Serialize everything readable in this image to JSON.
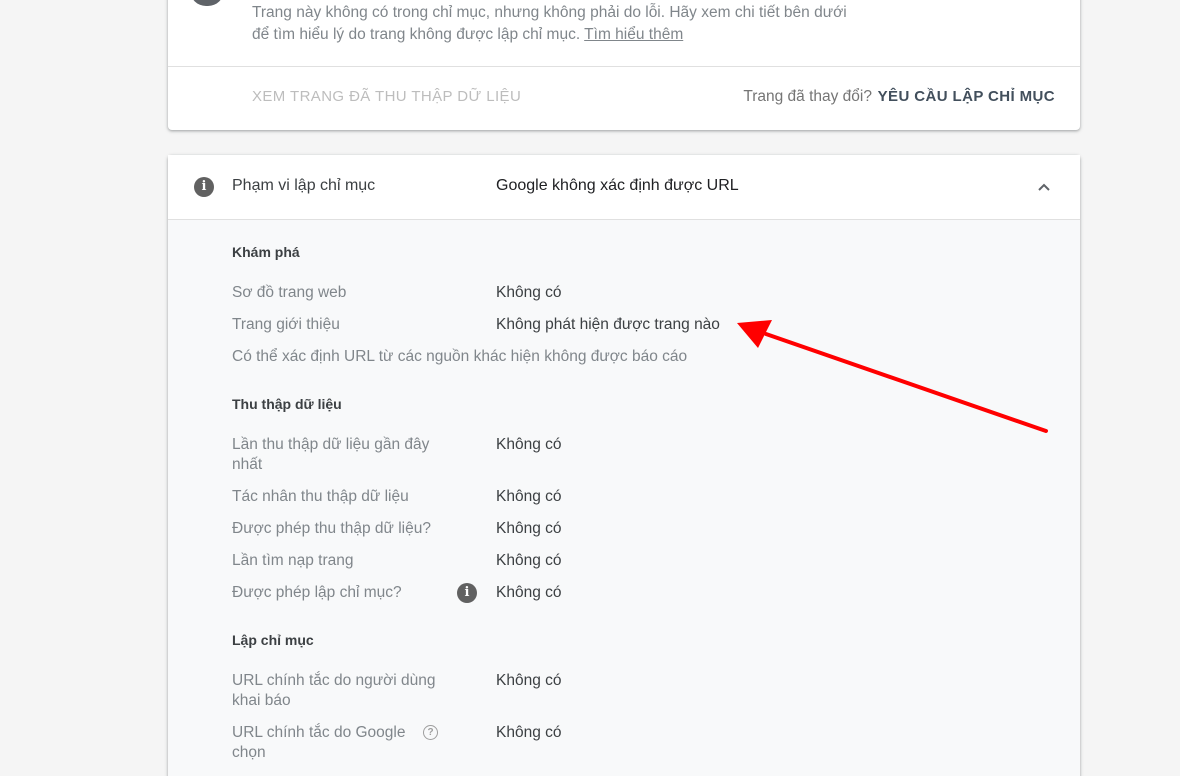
{
  "top_card": {
    "description": "Trang này không có trong chỉ mục, nhưng không phải do lỗi. Hãy xem chi tiết bên dưới để tìm hiểu lý do trang không được lập chỉ mục.",
    "learn_more": "Tìm hiểu thêm",
    "view_crawled_label": "XEM TRANG ĐÃ THU THẬP DỮ LIỆU",
    "page_changed_text": "Trang đã thay đổi?",
    "request_indexing_label": "YÊU CẦU LẬP CHỈ MỤC"
  },
  "coverage": {
    "title": "Phạm vi lập chỉ mục",
    "status": "Google không xác định được URL",
    "info_icon": "i",
    "sections": {
      "discovery": {
        "title": "Khám phá",
        "sitemap_label": "Sơ đồ trang web",
        "sitemap_value": "Không có",
        "referring_label": "Trang giới thiệu",
        "referring_value": "Không phát hiện được trang nào",
        "note": "Có thể xác định URL từ các nguồn khác hiện không được báo cáo"
      },
      "crawl": {
        "title": "Thu thập dữ liệu",
        "last_crawl_label": "Lần thu thập dữ liệu gần đây nhất",
        "last_crawl_value": "Không có",
        "crawler_label": "Tác nhân thu thập dữ liệu",
        "crawler_value": "Không có",
        "crawl_allowed_label": "Được phép thu thập dữ liệu?",
        "crawl_allowed_value": "Không có",
        "page_fetch_label": "Lần tìm nạp trang",
        "page_fetch_value": "Không có",
        "index_allowed_label": "Được phép lập chỉ mục?",
        "index_allowed_value": "Không có"
      },
      "indexing": {
        "title": "Lập chỉ mục",
        "user_canonical_label": "URL chính tắc do người dùng khai báo",
        "user_canonical_value": "Không có",
        "google_canonical_label": "URL chính tắc do Google chọn",
        "google_canonical_value": "Không có",
        "help_icon": "?"
      }
    }
  },
  "icons": {
    "info": "info-icon",
    "chevron": "chevron-up-icon",
    "help": "help-icon",
    "annotation": "red-arrow-annotation"
  },
  "colors": {
    "annotation_arrow": "#ff0000",
    "icon_gray": "#616161",
    "page_bg": "#f5f5f5"
  }
}
